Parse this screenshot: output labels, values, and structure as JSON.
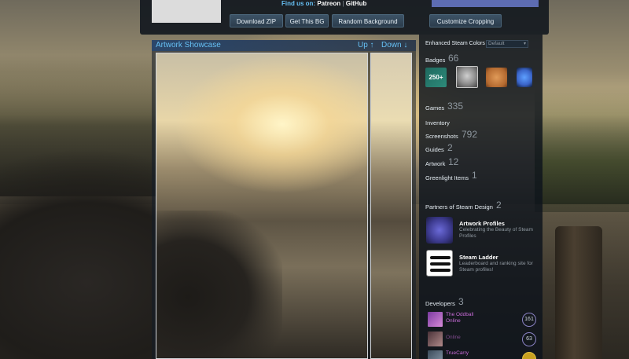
{
  "header": {
    "find_us_label": "Find us on:",
    "patreon": "Patreon",
    "separator": "|",
    "github": "GitHub",
    "buttons": {
      "download_zip": "Download ZIP",
      "get_this_bg": "Get This BG",
      "random_background": "Random Background",
      "customize_cropping": "Customize Cropping"
    }
  },
  "showcase": {
    "title": "Artwork Showcase",
    "up": "Up ↑",
    "down": "Down ↓"
  },
  "profile": {
    "colors_label": "Enhanced Steam Colors",
    "colors_value": "Default",
    "badges_label": "Badges",
    "badges_count": "66",
    "badge_250": "250+",
    "stats": [
      {
        "label": "Games",
        "value": "335"
      },
      {
        "label": "Inventory",
        "value": ""
      },
      {
        "label": "Screenshots",
        "value": "792"
      },
      {
        "label": "Guides",
        "value": "2"
      },
      {
        "label": "Artwork",
        "value": "12"
      },
      {
        "label": "Greenlight Items",
        "value": "1"
      }
    ],
    "partners_label": "Partners of Steam Design",
    "partners_count": "2",
    "partners": [
      {
        "name": "Artwork Profiles",
        "desc": "Celebrating the Beauty of Steam Profiles"
      },
      {
        "name": "Steam Ladder",
        "desc": "Leaderboard and ranking site for Steam profiles!"
      }
    ],
    "developers_label": "Developers",
    "developers_count": "3",
    "developers": [
      {
        "name": "The Oddball",
        "status": "Online",
        "level": "161"
      },
      {
        "name": "",
        "status": "Online",
        "level": "63"
      },
      {
        "name": "TrueCarry",
        "status": "Online",
        "level": ""
      }
    ]
  }
}
